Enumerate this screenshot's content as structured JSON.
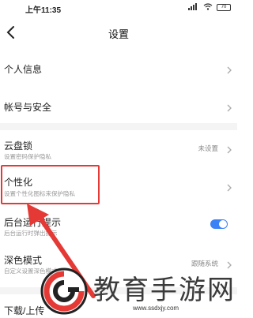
{
  "status_bar": {
    "time": "上午11:35",
    "battery": "70"
  },
  "nav": {
    "title": "设置"
  },
  "settings": {
    "personal_info": "个人信息",
    "account_security": "帐号与安全",
    "cloud_lock": {
      "title": "云盘锁",
      "subtitle": "设置密码保护隐私",
      "value": "未设置"
    },
    "personalize": {
      "title": "个性化",
      "subtitle": "设置个性化图标来保护隐私"
    },
    "background_prompt": {
      "title": "后台运行提示",
      "subtitle": "后台运行时弹出提示",
      "enabled": true
    },
    "dark_mode": {
      "title": "深色模式",
      "subtitle": "自定义设置深色模式",
      "value": "跟随系统"
    },
    "download_upload": {
      "title": "下载/上传"
    }
  },
  "watermark": {
    "text": "教育手游网",
    "url": "www.ssdxjy.com"
  },
  "colors": {
    "highlight_border": "#e53935",
    "toggle_on": "#3b82f6",
    "arrow": "#e53935"
  }
}
